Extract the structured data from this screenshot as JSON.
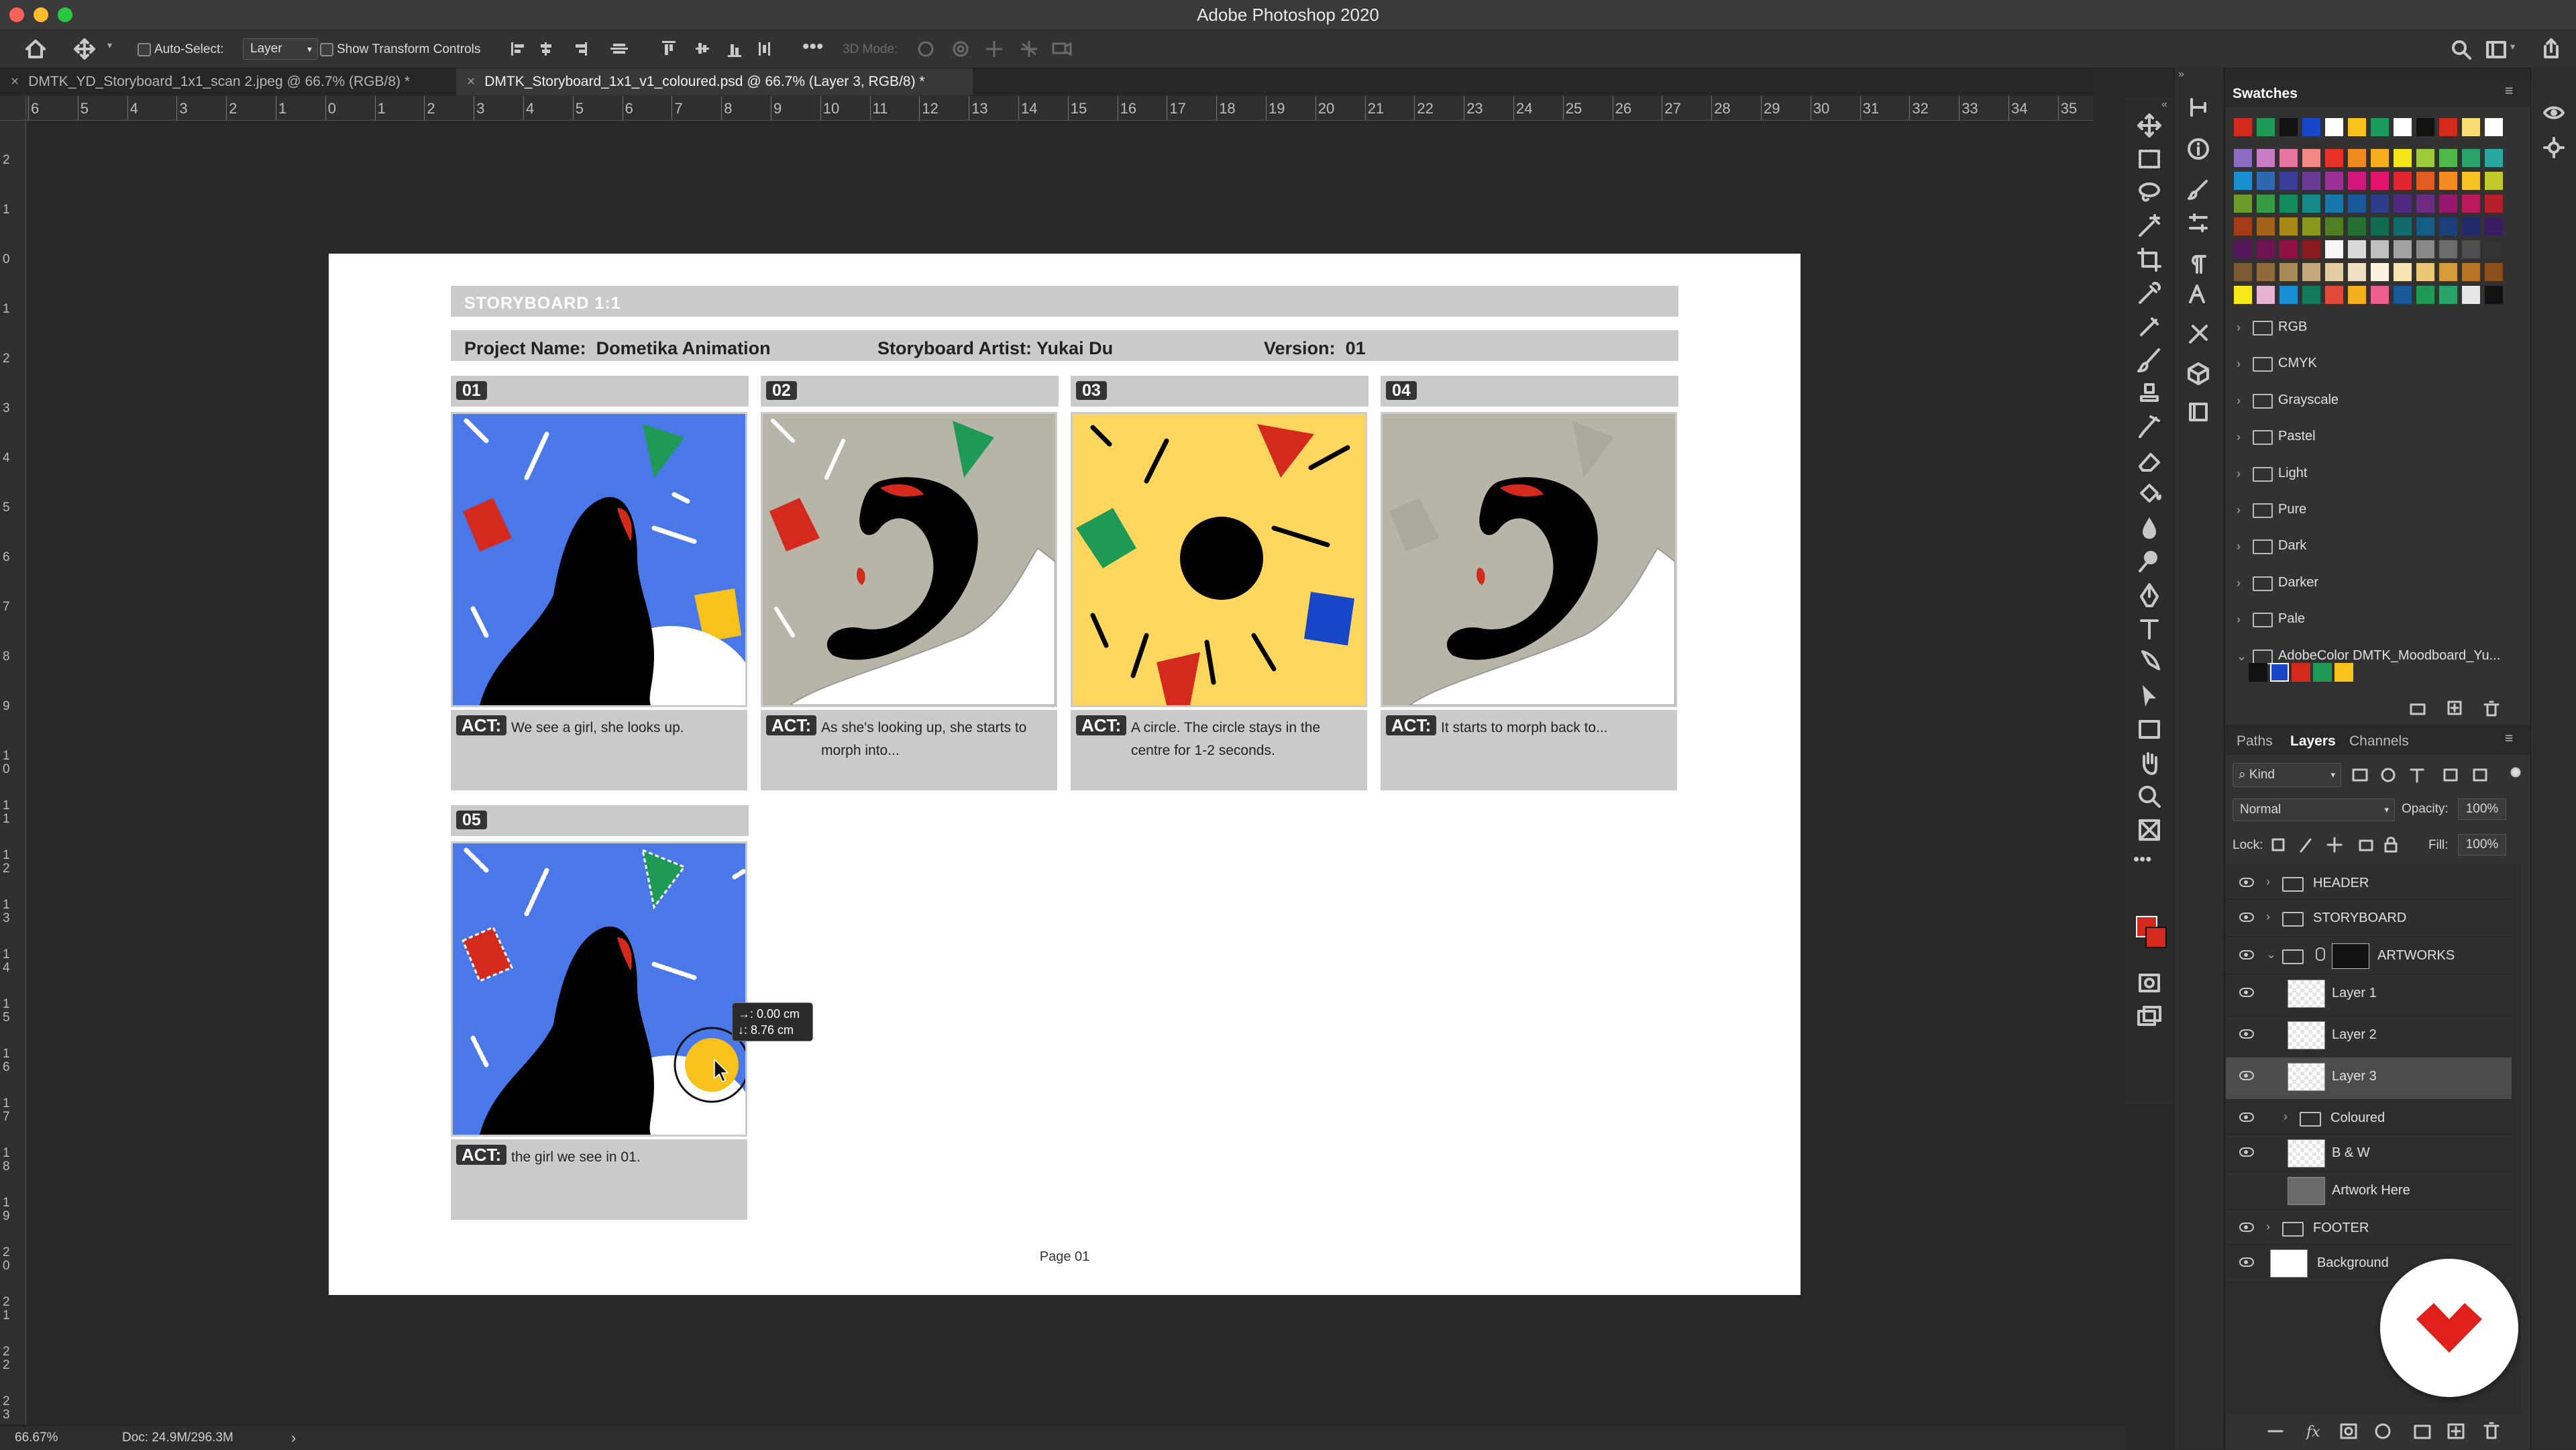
{
  "app": {
    "title": "Adobe Photoshop 2020"
  },
  "options_bar": {
    "auto_select_label": "Auto-Select:",
    "auto_select_value": "Layer",
    "show_transform_label": "Show Transform Controls",
    "mode_3d_label": "3D Mode:"
  },
  "tabs": [
    {
      "label": "DMTK_YD_Storyboard_1x1_scan 2.jpeg @ 66.7% (RGB/8) *",
      "active": false
    },
    {
      "label": "DMTK_Storyboard_1x1_v1_coloured.psd @ 66.7% (Layer 3, RGB/8) *",
      "active": true
    }
  ],
  "ruler": {
    "h_ticks": [
      "6",
      "5",
      "4",
      "3",
      "2",
      "1",
      "0",
      "1",
      "2",
      "3",
      "4",
      "5",
      "6",
      "7",
      "8",
      "9",
      "10",
      "11",
      "12",
      "13",
      "14",
      "15",
      "16",
      "17",
      "18",
      "19",
      "20",
      "21",
      "22",
      "23",
      "24",
      "25",
      "26",
      "27",
      "28",
      "29",
      "30",
      "31",
      "32",
      "33",
      "34",
      "35"
    ],
    "v_ticks": [
      "2",
      "1",
      "0",
      "1",
      "2",
      "3",
      "4",
      "5",
      "6",
      "7",
      "8",
      "9",
      "1 0",
      "1 1",
      "1 2",
      "1 3",
      "1 4",
      "1 5",
      "1 6",
      "1 7",
      "1 8",
      "1 9",
      "2 0",
      "2 1",
      "2 2",
      "2 3"
    ]
  },
  "document": {
    "header": "STORYBOARD 1:1",
    "project_label": "Project Name:",
    "project_name": "Dometika Animation",
    "artist_label": "Storyboard Artist:",
    "artist_name": "Yukai Du",
    "version_label": "Version:",
    "version": "01",
    "panels": [
      {
        "number": "01",
        "act_label": "ACT:",
        "act": "We see a girl, she looks up."
      },
      {
        "number": "02",
        "act_label": "ACT:",
        "act": "As she's looking up, she starts to morph into..."
      },
      {
        "number": "03",
        "act_label": "ACT:",
        "act": "A circle. The circle stays in the centre for 1-2 seconds."
      },
      {
        "number": "04",
        "act_label": "ACT:",
        "act": "It starts to morph back to..."
      },
      {
        "number": "05",
        "act_label": "ACT:",
        "act": "the girl we see in 01."
      }
    ],
    "footer": "Page 01"
  },
  "measure_tooltip": {
    "x": "→: 0.00 cm",
    "y": "↓: 8.76 cm"
  },
  "swatches_panel": {
    "title": "Swatches",
    "top_row": [
      "#d42a1e",
      "#1f9a55",
      "#111111",
      "#1846c8",
      "#ffffff",
      "#f7c21b",
      "#1a9a5c",
      "#ffffff",
      "#111111",
      "#d42a1e",
      "#f7dd72",
      "#ffffff"
    ],
    "groups": [
      "RGB",
      "CMYK",
      "Grayscale",
      "Pastel",
      "Light",
      "Pure",
      "Dark",
      "Darker",
      "Pale",
      "AdobeColor DMTK_Moodboard_Yu..."
    ],
    "adobe_colors": [
      "#111111",
      "#1846c8",
      "#d42a1e",
      "#1f9a55",
      "#f7c21b"
    ]
  },
  "layers_panel": {
    "tabs": [
      "Paths",
      "Layers",
      "Channels"
    ],
    "active_tab": "Layers",
    "filter": "Kind",
    "blend_mode": "Normal",
    "opacity_label": "Opacity:",
    "opacity": "100%",
    "lock_label": "Lock:",
    "fill_label": "Fill:",
    "fill": "100%",
    "layers": [
      {
        "name": "HEADER",
        "type": "group",
        "visible": true,
        "indent": 0
      },
      {
        "name": "STORYBOARD",
        "type": "group",
        "visible": true,
        "indent": 0
      },
      {
        "name": "ARTWORKS",
        "type": "group-open",
        "visible": true,
        "indent": 0
      },
      {
        "name": "Layer 1",
        "type": "layer",
        "visible": true,
        "indent": 1
      },
      {
        "name": "Layer 2",
        "type": "layer",
        "visible": true,
        "indent": 1
      },
      {
        "name": "Layer 3",
        "type": "layer",
        "visible": true,
        "indent": 1,
        "selected": true
      },
      {
        "name": "Coloured",
        "type": "group",
        "visible": true,
        "indent": 1
      },
      {
        "name": "B & W",
        "type": "layer",
        "visible": true,
        "indent": 1
      },
      {
        "name": "Artwork Here",
        "type": "layer",
        "visible": false,
        "indent": 1
      },
      {
        "name": "FOOTER",
        "type": "group",
        "visible": true,
        "indent": 0
      },
      {
        "name": "Background",
        "type": "background",
        "visible": true,
        "indent": 0
      }
    ]
  },
  "status": {
    "zoom": "66.67%",
    "doc": "Doc: 24.9M/296.3M"
  },
  "colors": {
    "red": "#d42a1e",
    "green": "#1f9a55",
    "blue": "#4a78e8",
    "yellow": "#f7c21b",
    "grey_bg": "#b6b5a8",
    "yellow_bg": "#ffd75e"
  }
}
